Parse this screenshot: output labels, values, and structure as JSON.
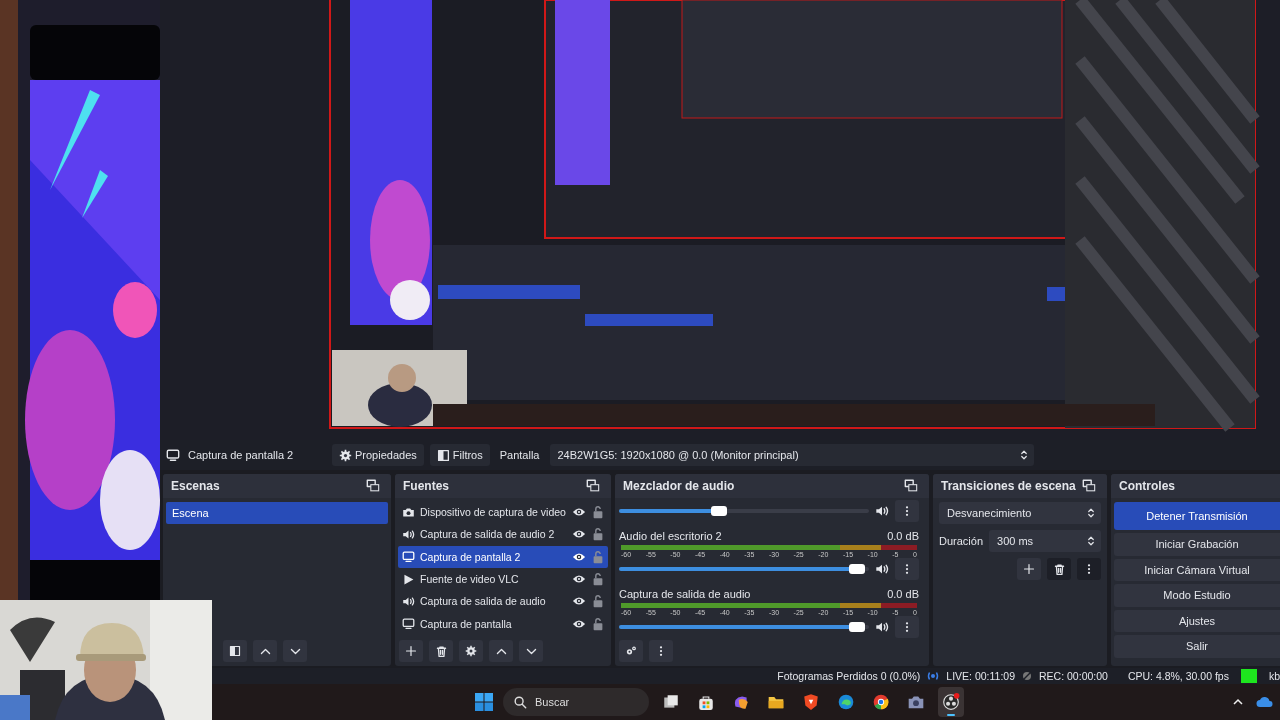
{
  "source_toolbar": {
    "source_name": "Captura de pantalla 2",
    "buttons": [
      {
        "label": "Propiedades",
        "kind": "gear"
      },
      {
        "label": "Filtros",
        "kind": "filter"
      }
    ],
    "display_label": "Pantalla",
    "display_value": "24B2W1G5: 1920x1080 @ 0.0 (Monitor principal)"
  },
  "scenes": {
    "title": "Escenas",
    "items": [
      {
        "name": "Escena",
        "selected": true
      }
    ]
  },
  "sources": {
    "title": "Fuentes",
    "items": [
      {
        "name": "Dispositivo de captura de video",
        "kind": "camera",
        "selected": false,
        "visible": true,
        "locked": false
      },
      {
        "name": "Captura de salida de audio 2",
        "kind": "audio",
        "selected": false,
        "visible": true,
        "locked": false
      },
      {
        "name": "Captura de pantalla 2",
        "kind": "display",
        "selected": true,
        "visible": true,
        "locked": false
      },
      {
        "name": "Fuente de video VLC",
        "kind": "media",
        "selected": false,
        "visible": true,
        "locked": false
      },
      {
        "name": "Captura de salida de audio",
        "kind": "audio",
        "selected": false,
        "visible": true,
        "locked": false
      },
      {
        "name": "Captura de pantalla",
        "kind": "display",
        "selected": false,
        "visible": true,
        "locked": false
      }
    ]
  },
  "mixer": {
    "title": "Mezclador de audio",
    "channels": [
      {
        "volume": {
          "level": 0.4
        }
      },
      {
        "name": "Audio del escritorio 2",
        "reading": "0.0 dB",
        "ticks": [
          "-60",
          "-55",
          "-50",
          "-45",
          "-40",
          "-35",
          "-30",
          "-25",
          "-20",
          "-15",
          "-10",
          "-5",
          "0"
        ],
        "volume": {
          "level": 0.95
        }
      },
      {
        "name": "Captura de salida de audio",
        "reading": "0.0 dB",
        "ticks": [
          "-60",
          "-55",
          "-50",
          "-45",
          "-40",
          "-35",
          "-30",
          "-25",
          "-20",
          "-15",
          "-10",
          "-5",
          "0"
        ],
        "volume": {
          "level": 0.95
        }
      }
    ]
  },
  "transitions": {
    "title": "Transiciones de escena",
    "transition": "Desvanecimiento",
    "duration_label": "Duración",
    "duration": "300 ms"
  },
  "controls": {
    "title": "Controles",
    "buttons": [
      {
        "label": "Detener Transmisión",
        "active": true
      },
      {
        "label": "Iniciar Grabación",
        "active": false
      },
      {
        "label": "Iniciar Cámara Virtual",
        "active": false
      },
      {
        "label": "Modo Estudio",
        "active": false
      },
      {
        "label": "Ajustes",
        "active": false
      },
      {
        "label": "Salir",
        "active": false
      }
    ]
  },
  "status_bar": {
    "dropped_frames": "Fotogramas Perdidos 0 (0.0%)",
    "live": "LIVE: 00:11:09",
    "rec": "REC: 00:00:00",
    "cpu": "CPU: 4.8%, 30.00 fps",
    "bitrate": "kb"
  },
  "taskbar": {
    "search": {
      "placeholder": "Buscar"
    },
    "apps": [
      {
        "kind": "taskview",
        "selected": false
      },
      {
        "kind": "store",
        "selected": false
      },
      {
        "kind": "copilot",
        "selected": false
      },
      {
        "kind": "folder",
        "selected": false
      },
      {
        "kind": "shield",
        "selected": false
      },
      {
        "kind": "edge",
        "selected": false
      },
      {
        "kind": "chrome",
        "selected": false
      },
      {
        "kind": "camera",
        "selected": false
      },
      {
        "kind": "obs",
        "selected": true
      }
    ]
  }
}
